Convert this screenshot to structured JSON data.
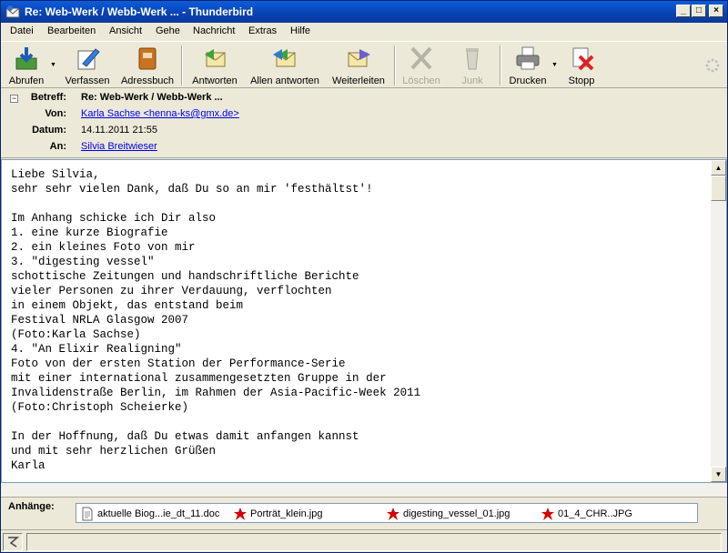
{
  "window": {
    "title": "Re: Web-Werk / Webb-Werk ... - Thunderbird"
  },
  "menu": [
    "Datei",
    "Bearbeiten",
    "Ansicht",
    "Gehe",
    "Nachricht",
    "Extras",
    "Hilfe"
  ],
  "toolbar": {
    "get": "Abrufen",
    "compose": "Verfassen",
    "addressbook": "Adressbuch",
    "reply": "Antworten",
    "replyall": "Allen antworten",
    "forward": "Weiterleiten",
    "delete": "Löschen",
    "junk": "Junk",
    "print": "Drucken",
    "stop": "Stopp"
  },
  "header": {
    "subject_label": "Betreff:",
    "subject": "Re: Web-Werk / Webb-Werk ...",
    "from_label": "Von:",
    "from": "Karla Sachse <henna-ks@gmx.de>",
    "date_label": "Datum:",
    "date": "14.11.2011 21:55",
    "to_label": "An:",
    "to": "Silvia Breitwieser"
  },
  "body": "Liebe Silvia,\nsehr sehr vielen Dank, daß Du so an mir 'festhältst'!\n\nIm Anhang schicke ich Dir also\n1. eine kurze Biografie\n2. ein kleines Foto von mir\n3. \"digesting vessel\"\nschottische Zeitungen und handschriftliche Berichte\nvieler Personen zu ihrer Verdauung, verflochten\nin einem Objekt, das entstand beim\nFestival NRLA Glasgow 2007\n(Foto:Karla Sachse)\n4. \"An Elixir Realigning\"\nFoto von der ersten Station der Performance-Serie\nmit einer international zusammengesetzten Gruppe in der\nInvalidenstraße Berlin, im Rahmen der Asia-Pacific-Week 2011\n(Foto:Christoph Scheierke)\n\nIn der Hoffnung, daß Du etwas damit anfangen kannst\nund mit sehr herzlichen Grüßen\nKarla",
  "attachments": {
    "label": "Anhänge:",
    "items": [
      "aktuelle Biog...ie_dt_11.doc",
      "Porträt_klein.jpg",
      "digesting_vessel_01.jpg",
      "01_4_CHR..JPG"
    ]
  },
  "icons": {
    "app": "thunderbird-icon",
    "online": "online-status-icon"
  },
  "colors": {
    "titlebar": "#0842b0",
    "link": "#0000ee"
  }
}
